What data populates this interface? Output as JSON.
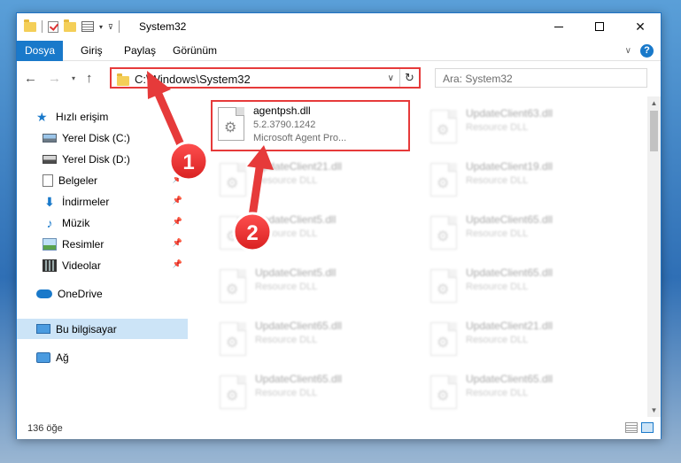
{
  "window": {
    "title": "System32",
    "controls": {
      "minimize": "minimize",
      "maximize": "maximize",
      "close": "✕"
    }
  },
  "ribbon": {
    "tabs": [
      "Dosya",
      "Giriş",
      "Paylaş",
      "Görünüm"
    ]
  },
  "navigation": {
    "address": "C:\\Windows\\System32",
    "search_placeholder": "Ara: System32"
  },
  "sidebar": {
    "items": [
      {
        "label": "Hızlı erişim",
        "icon": "star-icon"
      },
      {
        "label": "Yerel Disk (C:)",
        "icon": "drive-icon"
      },
      {
        "label": "Yerel Disk (D:)",
        "icon": "drive-icon"
      },
      {
        "label": "Belgeler",
        "icon": "documents-icon",
        "pinned": true
      },
      {
        "label": "İndirmeler",
        "icon": "download-icon",
        "pinned": true
      },
      {
        "label": "Müzik",
        "icon": "music-icon",
        "pinned": true
      },
      {
        "label": "Resimler",
        "icon": "pictures-icon",
        "pinned": true
      },
      {
        "label": "Videolar",
        "icon": "videos-icon",
        "pinned": true
      },
      {
        "label": "OneDrive",
        "icon": "cloud-icon"
      },
      {
        "label": "Bu bilgisayar",
        "icon": "computer-icon",
        "selected": true
      },
      {
        "label": "Ağ",
        "icon": "network-icon"
      }
    ]
  },
  "files": {
    "highlighted": {
      "name": "agentpsh.dll",
      "version": "5.2.3790.1242",
      "description": "Microsoft Agent Pro..."
    },
    "left_column": [
      {
        "name": "UpdateClient21.dll",
        "type": "Resource DLL"
      },
      {
        "name": "UpdateClient5.dll",
        "type": "Resource DLL"
      },
      {
        "name": "UpdateClient5.dll",
        "type": "Resource DLL"
      },
      {
        "name": "UpdateClient65.dll",
        "type": "Resource DLL"
      },
      {
        "name": "UpdateClient65.dll",
        "type": "Resource DLL"
      }
    ],
    "right_column": [
      {
        "name": "UpdateClient63.dll",
        "type": "Resource DLL"
      },
      {
        "name": "UpdateClient19.dll",
        "type": "Resource DLL"
      },
      {
        "name": "UpdateClient65.dll",
        "type": "Resource DLL"
      },
      {
        "name": "UpdateClient65.dll",
        "type": "Resource DLL"
      },
      {
        "name": "UpdateClient21.dll",
        "type": "Resource DLL"
      },
      {
        "name": "UpdateClient65.dll",
        "type": "Resource DLL"
      }
    ]
  },
  "status": {
    "item_count": "136 öğe"
  },
  "annotations": {
    "badge_1": "1",
    "badge_2": "2",
    "color": "#e63a3a"
  }
}
